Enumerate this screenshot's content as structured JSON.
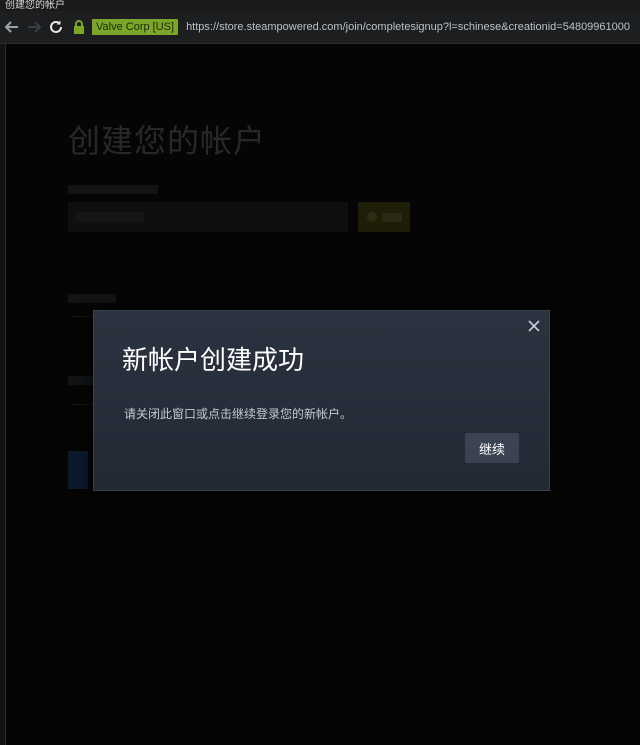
{
  "window": {
    "title": "创建您的帐户"
  },
  "browser": {
    "back_icon": "arrow-left-icon",
    "forward_icon": "arrow-right-icon",
    "reload_icon": "reload-icon",
    "lock_icon": "lock-icon",
    "certificate_label": "Valve Corp [US]",
    "url": "https://store.steampowered.com/join/completesignup?l=schinese&creationid=54809961000"
  },
  "page": {
    "heading": "创建您的帐户"
  },
  "modal": {
    "title": "新帐户创建成功",
    "message": "请关闭此窗口或点击继续登录您的新帐户。",
    "continue_label": "继续",
    "close_icon": "close-icon"
  },
  "colors": {
    "accent_green": "#7ba62a",
    "modal_bg": "#2c3340",
    "button_bg": "#3b4352"
  }
}
